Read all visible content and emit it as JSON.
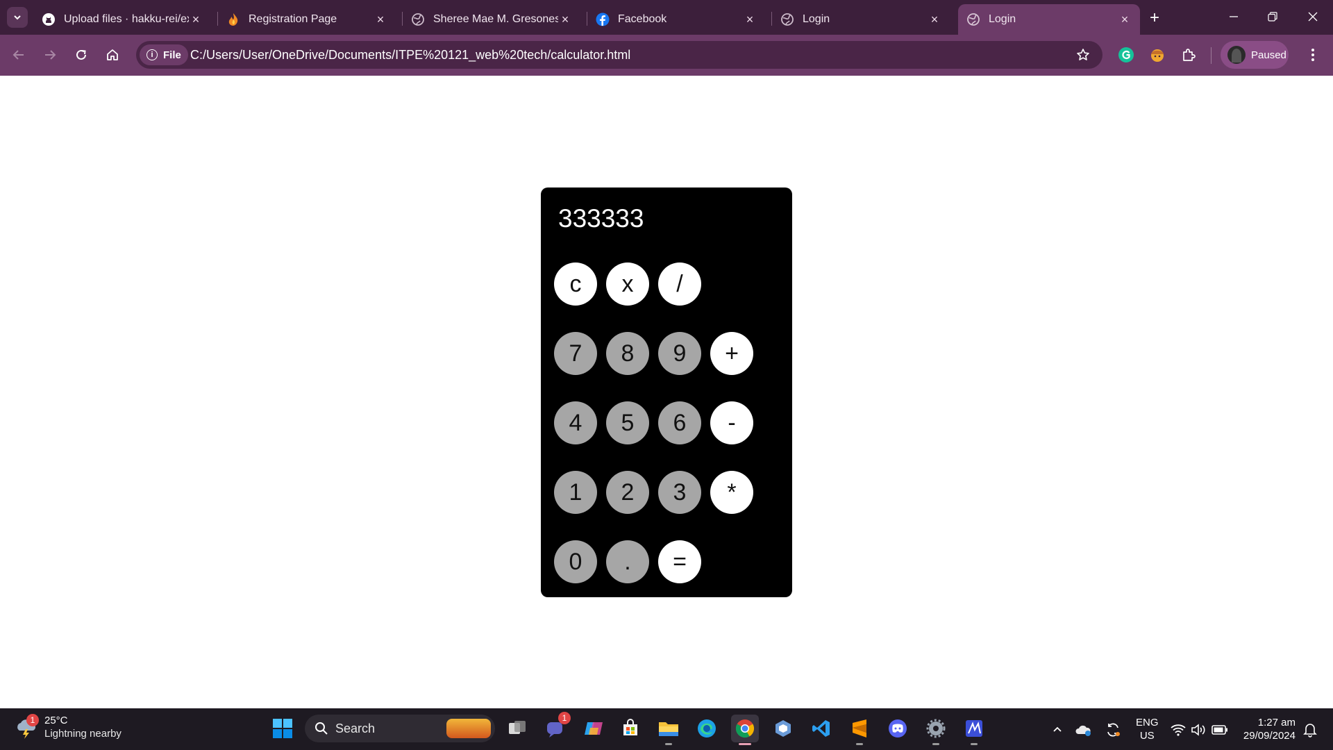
{
  "browser": {
    "tabs": [
      {
        "title": "Upload files · hakku-rei/exc",
        "favicon": "github-icon"
      },
      {
        "title": "Registration Page",
        "favicon": "flame-icon"
      },
      {
        "title": "Sheree Mae M. Gresones",
        "favicon": "globe-icon"
      },
      {
        "title": "Facebook",
        "favicon": "facebook-icon"
      },
      {
        "title": "Login",
        "favicon": "globe-icon"
      },
      {
        "title": "Login",
        "favicon": "globe-icon",
        "active": true
      }
    ],
    "file_chip": "File",
    "url": "C:/Users/User/OneDrive/Documents/ITPE%20121_web%20tech/calculator.html",
    "profile_label": "Paused"
  },
  "calculator": {
    "display": "333333",
    "keys": [
      "c",
      "x",
      "/",
      "7",
      "8",
      "9",
      "+",
      "4",
      "5",
      "6",
      "-",
      "1",
      "2",
      "3",
      "*",
      "0",
      ".",
      "="
    ]
  },
  "taskbar": {
    "weather_temp": "25°C",
    "weather_condition": "Lightning nearby",
    "weather_badge": "1",
    "search_label": "Search",
    "teams_badge": "1",
    "lang_line1": "ENG",
    "lang_line2": "US",
    "time": "1:27 am",
    "date": "29/09/2024"
  },
  "colors": {
    "tabstrip": "#3c1f3b",
    "toolbar": "#6c3b68",
    "calc_body": "#000000",
    "operator_key": "#ffffff",
    "number_key": "#a6a6a6"
  }
}
